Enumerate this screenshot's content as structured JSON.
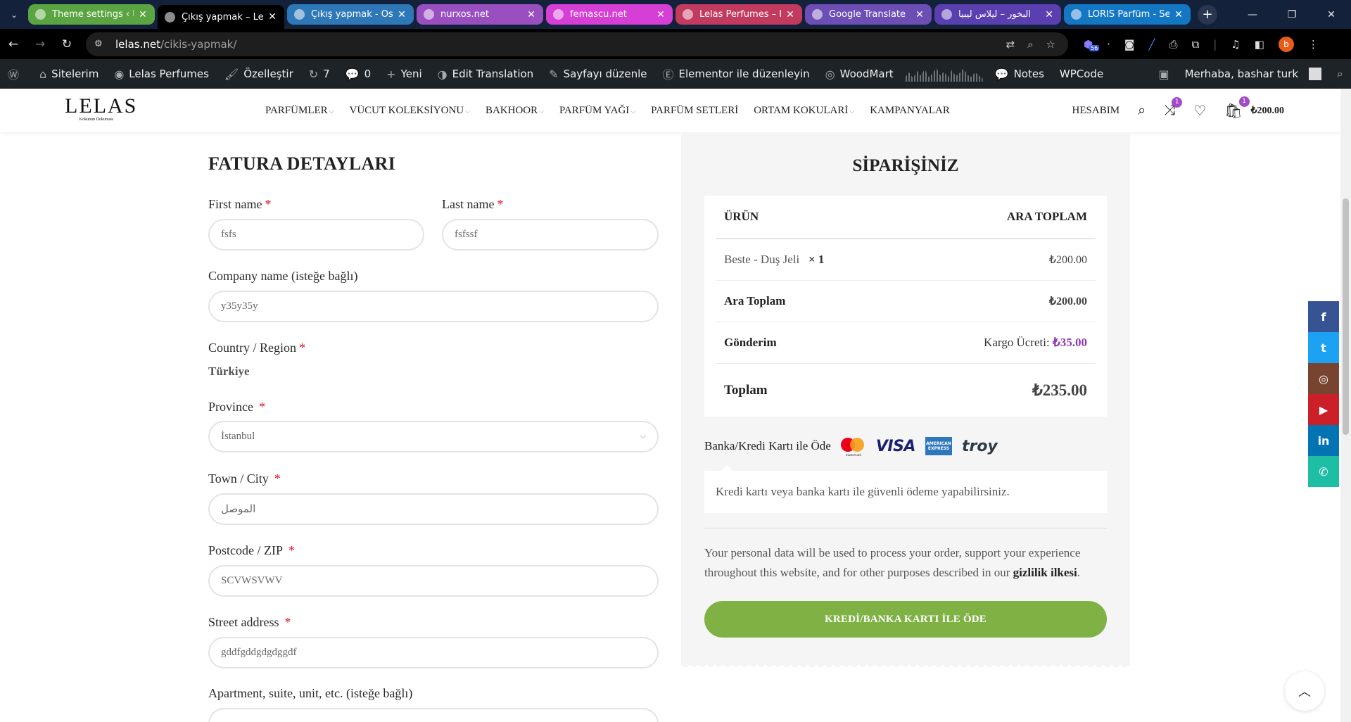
{
  "browser": {
    "tabs": [
      {
        "title": "Theme settings ‹ ليبيا",
        "color": "#5aa542"
      },
      {
        "title": "Çıkış yapmak – Lelas",
        "color": "#000000",
        "active": true
      },
      {
        "title": "Çıkış yapmak - Osma",
        "color": "#2f78b8"
      },
      {
        "title": "nurxos.net",
        "color": "#9a4fc0"
      },
      {
        "title": "femascu.net",
        "color": "#d63fd6"
      },
      {
        "title": "Lelas Perfumes – Kol",
        "color": "#c33a5f"
      },
      {
        "title": "Google Translate",
        "color": "#6d4eb5"
      },
      {
        "title": "البخور – ليلاس ليبيا",
        "color": "#5a3fb0"
      },
      {
        "title": "LORİS Parfüm - Seni",
        "color": "#1477c4"
      }
    ],
    "url_host": "lelas.net",
    "url_path": "/cikis-yapmak/",
    "profile_initial": "b",
    "ext_badge": "56"
  },
  "adminbar": {
    "items": [
      {
        "icon": "wordpress-icon",
        "label": ""
      },
      {
        "icon": "home-icon",
        "label": "Sitelerim"
      },
      {
        "icon": "dashboard-icon",
        "label": "Lelas Perfumes"
      },
      {
        "icon": "brush-icon",
        "label": "Özelleştir"
      },
      {
        "icon": "refresh-icon",
        "label": "7"
      },
      {
        "icon": "comment-icon",
        "label": "0"
      },
      {
        "icon": "plus-icon",
        "label": "Yeni"
      },
      {
        "icon": "translate-icon",
        "label": "Edit Translation"
      },
      {
        "icon": "pencil-icon",
        "label": "Sayfayı düzenle"
      },
      {
        "icon": "elementor-icon",
        "label": "Elementor ile düzenleyin"
      },
      {
        "icon": "woodmart-icon",
        "label": "WoodMart"
      }
    ],
    "notes": "Notes",
    "wpcode": "WPCode",
    "greeting": "Merhaba, bashar turk"
  },
  "site": {
    "logo": "LELAS",
    "logo_sub": "Kokunun Dokunusu",
    "nav": [
      {
        "label": "PARFÜMLER",
        "dropdown": true
      },
      {
        "label": "VÜCUT KOLEKSİYONU",
        "dropdown": true
      },
      {
        "label": "BAKHOOR",
        "dropdown": true
      },
      {
        "label": "PARFÜM YAĞI",
        "dropdown": true
      },
      {
        "label": "PARFÜM SETLERİ",
        "dropdown": false
      },
      {
        "label": "ORTAM KOKULARİ",
        "dropdown": true
      },
      {
        "label": "KAMPANYALAR",
        "dropdown": false
      }
    ],
    "account": "HESABIM",
    "compare_count": "1",
    "cart_count": "1",
    "cart_total": "₺200.00"
  },
  "billing": {
    "title": "FATURA DETAYLARI",
    "first_name_label": "First name",
    "first_name_value": "fsfs",
    "last_name_label": "Last name",
    "last_name_value": "fsfssf",
    "company_label": "Company name (isteğe bağlı)",
    "company_value": "y35y35y",
    "country_label": "Country / Region",
    "country_value": "Türkiye",
    "province_label": "Province",
    "province_value": "İstanbul",
    "city_label": "Town / City",
    "city_value": "الموصل",
    "postcode_label": "Postcode / ZIP",
    "postcode_value": "SCVWSVWV",
    "street_label": "Street address",
    "street_value": "gddfgddgdgdggdf",
    "apartment_label": "Apartment, suite, unit, etc. (isteğe bağlı)",
    "apartment_value": "",
    "required_mark": "*"
  },
  "order": {
    "title": "SİPARİŞİNİZ",
    "col_product": "ÜRÜN",
    "col_subtotal": "ARA TOPLAM",
    "item_name": "Beste - Duş Jeli",
    "item_qty": "× 1",
    "item_price": "₺200.00",
    "subtotal_label": "Ara Toplam",
    "subtotal_value": "₺200.00",
    "shipping_label": "Gönderim",
    "shipping_method": "Kargo Ücreti:",
    "shipping_value": "₺35.00",
    "total_label": "Toplam",
    "total_value": "₺235.00",
    "payment_label": "Banka/Kredi Kartı ile Öde",
    "payment_desc": "Kredi kartı veya banka kartı ile güvenli ödeme yapabilirsiniz.",
    "privacy_text": "Your personal data will be used to process your order, support your experience throughout this website, and for other purposes described in our",
    "privacy_link": "gizlilik ilkesi",
    "privacy_end": ".",
    "place_order": "KREDİ/BANKA KARTI İLE ÖDE",
    "cards": {
      "mastercard": "mastercard",
      "visa": "VISA",
      "amex": "AMERICAN EXPRESS",
      "troy": "troy"
    }
  },
  "social": [
    {
      "icon": "facebook-icon",
      "glyph": "f",
      "color": "#365493"
    },
    {
      "icon": "twitter-icon",
      "glyph": "t",
      "color": "#1da1f2"
    },
    {
      "icon": "instagram-icon",
      "glyph": "◎",
      "color": "#774430"
    },
    {
      "icon": "youtube-icon",
      "glyph": "▶",
      "color": "#cb2027"
    },
    {
      "icon": "linkedin-icon",
      "glyph": "in",
      "color": "#0274b3"
    },
    {
      "icon": "whatsapp-icon",
      "glyph": "✆",
      "color": "#1ebea5"
    }
  ],
  "colors": {
    "accent": "#8f3ab0",
    "button": "#7fb144",
    "required": "#e01020"
  }
}
